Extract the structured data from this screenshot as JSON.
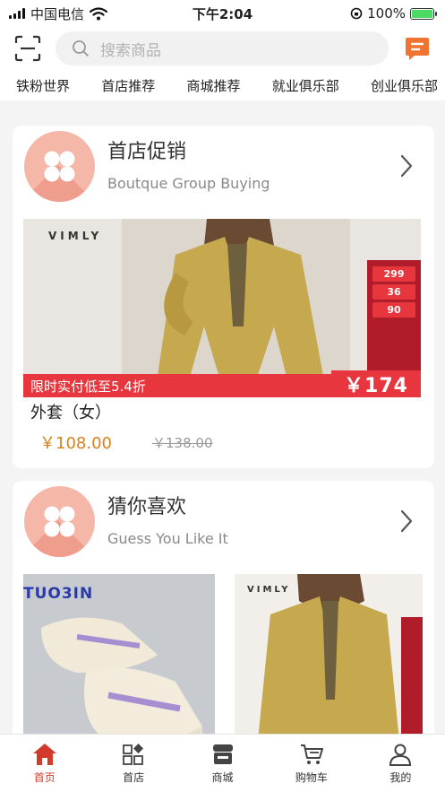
{
  "status_bar": {
    "carrier": "中国电信",
    "time": "下午2:04",
    "battery": "100%",
    "battery_level": 1.0
  },
  "header": {
    "search_placeholder": "搜索商品",
    "scan_icon": "scan-icon",
    "message_icon": "message-icon"
  },
  "category_tabs": [
    "铁粉世界",
    "首店推荐",
    "商城推荐",
    "就业俱乐部",
    "创业俱乐部"
  ],
  "sections": {
    "promo": {
      "title": "首店促销",
      "subtitle": "Boutque Group Buying",
      "banner": {
        "brand": "VIMLY",
        "strip_text": "限时实付低至5.4折",
        "price_tag": "￥174",
        "side_tags": [
          "299",
          "36",
          "90"
        ]
      },
      "product": {
        "name": "外套（女）",
        "price": "￥108.00",
        "original_price": "￥138.00"
      }
    },
    "guess": {
      "title": "猜你喜欢",
      "subtitle": "Guess You Like It",
      "items": [
        {
          "brand": "TUO3IN"
        },
        {
          "brand": "VIMLY"
        }
      ]
    }
  },
  "bottom_nav": [
    {
      "label": "首页",
      "icon": "home-icon",
      "active": true
    },
    {
      "label": "首店",
      "icon": "store-grid-icon",
      "active": false
    },
    {
      "label": "商城",
      "icon": "mall-icon",
      "active": false
    },
    {
      "label": "购物车",
      "icon": "cart-icon",
      "active": false
    },
    {
      "label": "我的",
      "icon": "profile-icon",
      "active": false
    }
  ],
  "colors": {
    "accent": "#d23a2b",
    "price": "#d7811f",
    "logo_bg": "#f4b7a8",
    "message_icon": "#f0742f"
  }
}
